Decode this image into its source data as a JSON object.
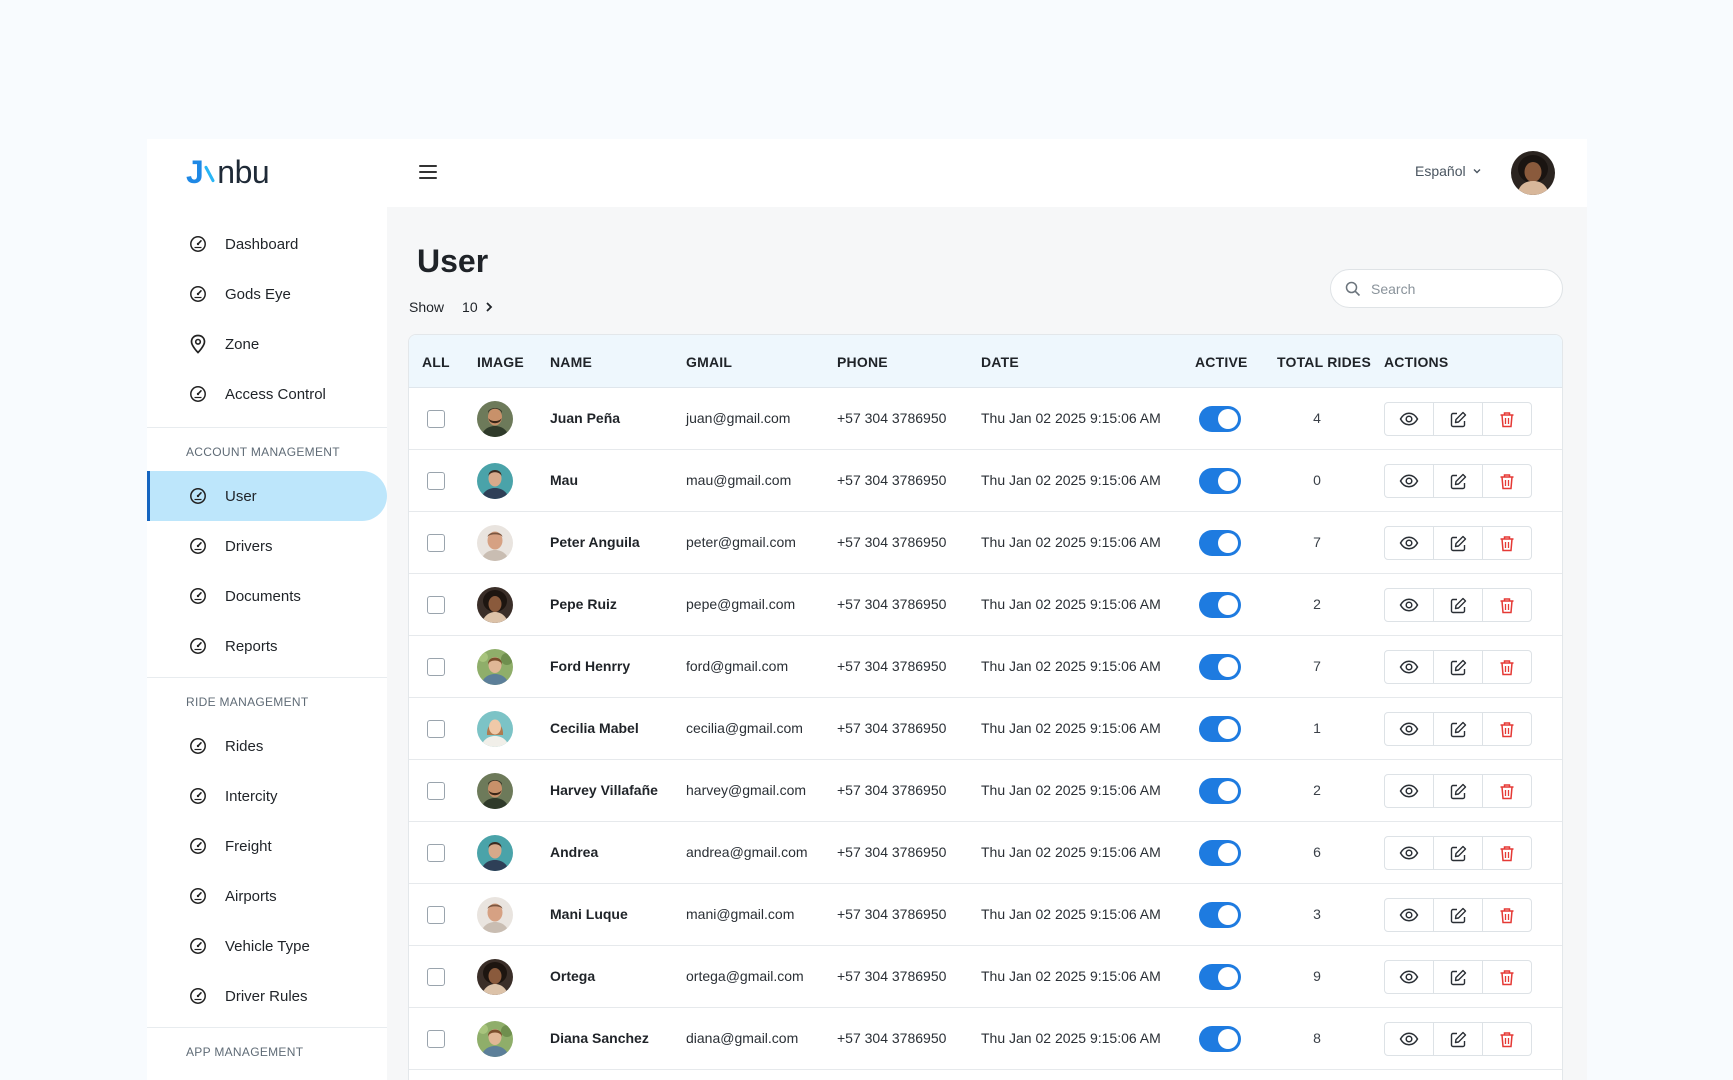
{
  "brand": {
    "logo_j": "J",
    "logo_rest": "nbu"
  },
  "sidebar": {
    "top_items": [
      {
        "label": "Dashboard",
        "icon": "gauge-icon"
      },
      {
        "label": "Gods Eye",
        "icon": "gauge-icon"
      },
      {
        "label": "Zone",
        "icon": "map-pin-icon"
      },
      {
        "label": "Access Control",
        "icon": "gauge-icon"
      }
    ],
    "account_label": "ACCOUNT MANAGEMENT",
    "account_items": [
      {
        "label": "User",
        "icon": "gauge-icon",
        "active": true
      },
      {
        "label": "Drivers",
        "icon": "gauge-icon"
      },
      {
        "label": "Documents",
        "icon": "gauge-icon"
      },
      {
        "label": "Reports",
        "icon": "gauge-icon"
      }
    ],
    "ride_label": "RIDE MANAGEMENT",
    "ride_items": [
      {
        "label": "Rides",
        "icon": "gauge-icon"
      },
      {
        "label": "Intercity",
        "icon": "gauge-icon"
      },
      {
        "label": "Freight",
        "icon": "gauge-icon"
      },
      {
        "label": "Airports",
        "icon": "gauge-icon"
      },
      {
        "label": "Vehicle Type",
        "icon": "gauge-icon"
      },
      {
        "label": "Driver Rules",
        "icon": "gauge-icon"
      }
    ],
    "app_label": "APP MANAGEMENT"
  },
  "topbar": {
    "language": "Español"
  },
  "main": {
    "title": "User",
    "show_label": "Show",
    "show_value": "10",
    "search_placeholder": "Search"
  },
  "table": {
    "headers": [
      "ALL",
      "IMAGE",
      "NAME",
      "GMAIL",
      "PHONE",
      "DATE",
      "ACTIVE",
      "TOTAL RIDES",
      "ACTIONS"
    ],
    "rows": [
      {
        "name": "Juan Peña",
        "email": "juan@gmail.com",
        "phone": "+57 304 3786950",
        "date": "Thu Jan 02 2025 9:15:06 AM",
        "active": true,
        "rides": "4",
        "avatar": "man-beard"
      },
      {
        "name": "Mau",
        "email": "mau@gmail.com",
        "phone": "+57 304 3786950",
        "date": "Thu Jan 02 2025 9:15:06 AM",
        "active": true,
        "rides": "0",
        "avatar": "man-teal"
      },
      {
        "name": "Peter Anguila",
        "email": "peter@gmail.com",
        "phone": "+57 304 3786950",
        "date": "Thu Jan 02 2025 9:15:06 AM",
        "active": true,
        "rides": "7",
        "avatar": "man-bald"
      },
      {
        "name": "Pepe Ruiz",
        "email": "pepe@gmail.com",
        "phone": "+57 304 3786950",
        "date": "Thu Jan 02 2025 9:15:06 AM",
        "active": true,
        "rides": "2",
        "avatar": "woman-curly"
      },
      {
        "name": "Ford Henrry",
        "email": "ford@gmail.com",
        "phone": "+57 304 3786950",
        "date": "Thu Jan 02 2025 9:15:06 AM",
        "active": true,
        "rides": "7",
        "avatar": "woman-green"
      },
      {
        "name": "Cecilia  Mabel",
        "email": "cecilia@gmail.com",
        "phone": "+57 304 3786950",
        "date": "Thu Jan 02 2025 9:15:06 AM",
        "active": true,
        "rides": "1",
        "avatar": "woman-teal"
      },
      {
        "name": "Harvey Villafañe",
        "email": "harvey@gmail.com",
        "phone": "+57 304 3786950",
        "date": "Thu Jan 02 2025 9:15:06 AM",
        "active": true,
        "rides": "2",
        "avatar": "man-beard"
      },
      {
        "name": "Andrea",
        "email": "andrea@gmail.com",
        "phone": "+57 304 3786950",
        "date": "Thu Jan 02 2025 9:15:06 AM",
        "active": true,
        "rides": "6",
        "avatar": "man-teal"
      },
      {
        "name": "Mani Luque",
        "email": "mani@gmail.com",
        "phone": "+57 304 3786950",
        "date": "Thu Jan 02 2025 9:15:06 AM",
        "active": true,
        "rides": "3",
        "avatar": "man-bald"
      },
      {
        "name": "Ortega",
        "email": "ortega@gmail.com",
        "phone": "+57 304 3786950",
        "date": "Thu Jan 02 2025 9:15:06 AM",
        "active": true,
        "rides": "9",
        "avatar": "woman-curly"
      },
      {
        "name": "Diana Sanchez",
        "email": "diana@gmail.com",
        "phone": "+57 304 3786950",
        "date": "Thu Jan 02 2025 9:15:06 AM",
        "active": true,
        "rides": "8",
        "avatar": "woman-green"
      }
    ]
  },
  "colors": {
    "accent": "#1e7be0",
    "active_nav": "#bde6fb",
    "delete": "#e53935",
    "header_bg": "#eef7fd"
  }
}
